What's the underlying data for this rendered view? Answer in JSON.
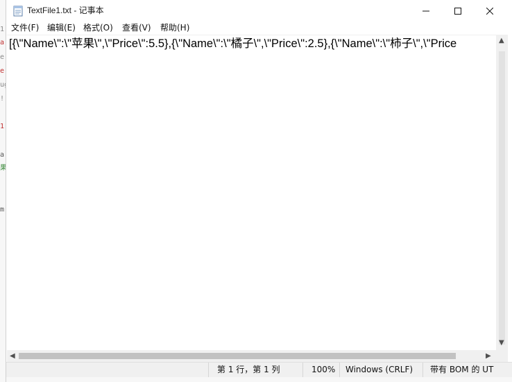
{
  "window": {
    "title": "TextFile1.txt - 记事本",
    "icon": "notepad-icon",
    "controls": [
      "minimize-icon",
      "maximize-icon",
      "close-icon"
    ]
  },
  "menu": {
    "file": "文件(F)",
    "edit": "编辑(E)",
    "format": "格式(O)",
    "view": "查看(V)",
    "help": "帮助(H)"
  },
  "editor": {
    "content": "[{\\\"Name\\\":\\\"苹果\\\",\\\"Price\\\":5.5},{\\\"Name\\\":\\\"橘子\\\",\\\"Price\\\":2.5},{\\\"Name\\\":\\\"柿子\\\",\\\"Price"
  },
  "status": {
    "position": "第 1 行，第 1 列",
    "zoom": "100%",
    "line_ending": "Windows (CRLF)",
    "encoding": "带有 BOM 的 UT"
  },
  "background_fragments": [
    "1",
    "a",
    "e",
    "e",
    "ug",
    "!",
    "1",
    "a",
    "果",
    "m"
  ]
}
